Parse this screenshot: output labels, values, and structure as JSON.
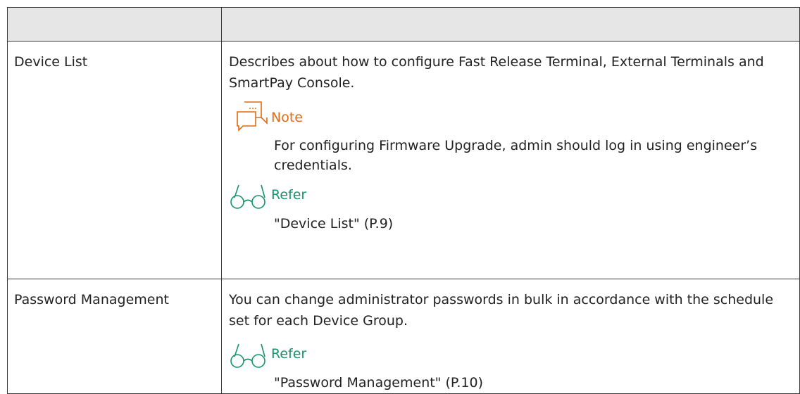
{
  "table": {
    "header": [
      "",
      ""
    ],
    "rows": [
      {
        "term": "Device List",
        "description": "Describes about how to configure Fast Release Terminal, External Terminals and SmartPay Console.",
        "note": {
          "title": "Note",
          "icon": "note-icon",
          "color": "#e06a12",
          "text": "For configuring Firmware Upgrade, admin should log in using engineer’s credentials."
        },
        "refer": {
          "title": "Refer",
          "icon": "glasses-icon",
          "color": "#14956b",
          "text": "\"Device List\" (P.9)"
        }
      },
      {
        "term": "Password Management",
        "description": "You can change administrator passwords in bulk in accordance with the schedule set for each Device Group.",
        "refer": {
          "title": "Refer",
          "icon": "glasses-icon",
          "color": "#14956b",
          "text": "\"Password Management\" (P.10)"
        }
      }
    ]
  }
}
